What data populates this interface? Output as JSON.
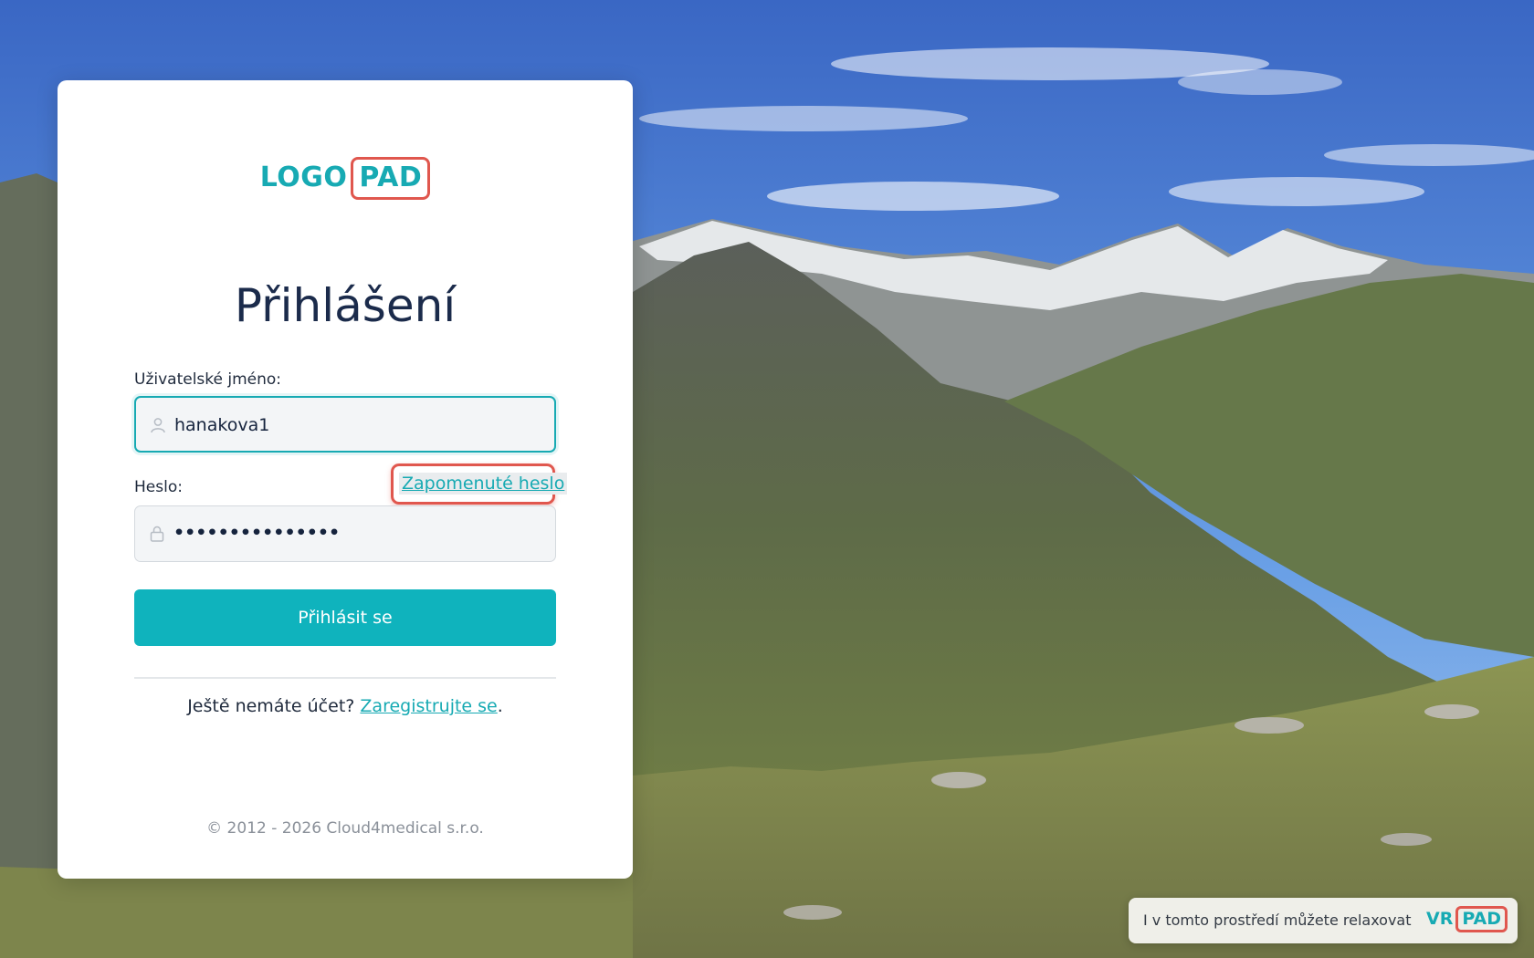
{
  "logo": {
    "part1": "LOGO",
    "part2": "PAD"
  },
  "title": "Přihlášení",
  "username": {
    "label": "Uživatelské jméno:",
    "value": "hanakova1"
  },
  "password": {
    "label": "Heslo:",
    "masked_value": "•••••••••••••••",
    "forgot_link": "Zapomenuté heslo"
  },
  "login_button": "Přihlásit se",
  "register": {
    "prompt": "Ještě nemáte účet?",
    "link": "Zaregistrujte se",
    "suffix": "."
  },
  "footer": "© 2012 - 2026 Cloud4medical s.r.o.",
  "vr_banner": {
    "text": "I v tomto prostředí můžete relaxovat",
    "logo_part1": "VR",
    "logo_part2": "PAD"
  },
  "icons": {
    "username": "user-icon",
    "password": "lock-icon"
  },
  "colors": {
    "accent": "#17aab3",
    "button": "#0fb3bd",
    "highlight": "#e0574e",
    "title": "#1b2b4b"
  }
}
